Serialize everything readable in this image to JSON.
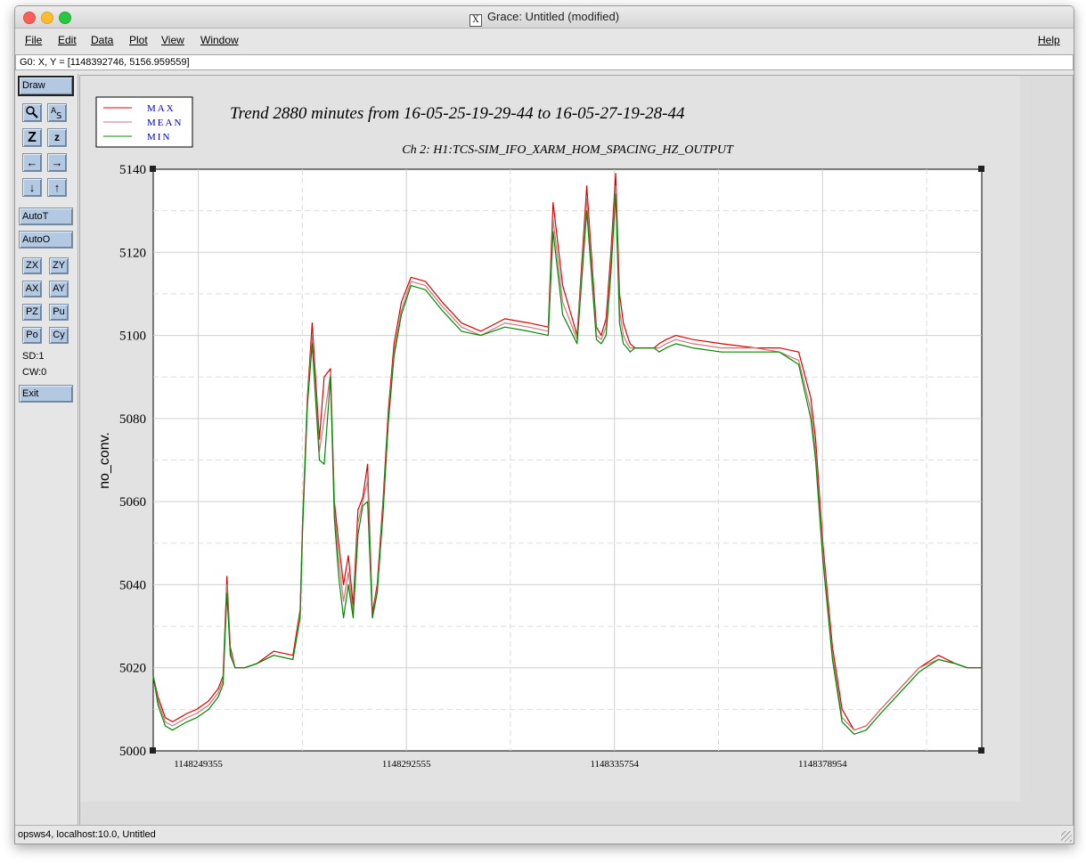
{
  "window": {
    "title": "Grace: Untitled (modified)"
  },
  "menu": {
    "file": "File",
    "edit": "Edit",
    "data": "Data",
    "plot": "Plot",
    "view": "View",
    "window": "Window",
    "help": "Help"
  },
  "status_line": "G0: X, Y = [1148392746, 5156.959559]",
  "toolbar": {
    "draw": "Draw",
    "auto_t": "AutoT",
    "auto_o": "AutoO",
    "zx": "ZX",
    "zy": "ZY",
    "ax": "AX",
    "ay": "AY",
    "pz": "PZ",
    "pu": "Pu",
    "po": "Po",
    "cy": "Cy",
    "sd": "SD:1",
    "cw": "CW:0",
    "exit": "Exit",
    "icons": [
      "magnifier-icon",
      "autoscale-text-icon",
      "zoom-in-icon",
      "zoom-out-icon",
      "arrow-left-icon",
      "arrow-right-icon",
      "arrow-down-icon",
      "arrow-up-icon"
    ]
  },
  "bottom_status": "opsws4, localhost:10.0, Untitled",
  "chart_data": {
    "type": "line",
    "title": "Trend 2880 minutes from 16-05-25-19-29-44 to 16-05-27-19-28-44",
    "subtitle": "Ch 2: H1:TCS-SIM_IFO_XARM_HOM_SPACING_HZ_OUTPUT",
    "xlabel": "",
    "ylabel": "no_conv.",
    "xlim": [
      1148240000,
      1148412000
    ],
    "ylim": [
      5000,
      5140
    ],
    "x_ticks": [
      1148249355,
      1148292555,
      1148335754,
      1148378954
    ],
    "x_tick_labels": [
      "1148249355",
      "1148292555",
      "1148335754",
      "1148378954"
    ],
    "y_ticks": [
      5000,
      5020,
      5040,
      5060,
      5080,
      5100,
      5120,
      5140
    ],
    "y_tick_labels": [
      "5000",
      "5020",
      "5040",
      "5060",
      "5080",
      "5100",
      "5120",
      "5140"
    ],
    "grid": true,
    "legend_position": "top-left",
    "legend": [
      "MAX",
      "MEAN",
      "MIN"
    ],
    "colors": {
      "max": "#dd0000",
      "mean": "#cc7777",
      "min": "#008800",
      "legend_text": "#0000cc"
    },
    "x": [
      1148240000,
      1148241000,
      1148242500,
      1148244000,
      1148245500,
      1148247000,
      1148249000,
      1148251500,
      1148253500,
      1148254500,
      1148255300,
      1148256000,
      1148257000,
      1148259000,
      1148261500,
      1148265000,
      1148269000,
      1148270500,
      1148271000,
      1148272000,
      1148273000,
      1148274500,
      1148275500,
      1148276800,
      1148277600,
      1148278500,
      1148279500,
      1148280500,
      1148281500,
      1148282500,
      1148283500,
      1148284500,
      1148285500,
      1148286500,
      1148287700,
      1148288800,
      1148290000,
      1148291500,
      1148293500,
      1148296500,
      1148300000,
      1148304000,
      1148308000,
      1148313000,
      1148318000,
      1148322000,
      1148323000,
      1148325000,
      1148328000,
      1148330000,
      1148332000,
      1148333000,
      1148334000,
      1148335000,
      1148336000,
      1148336800,
      1148337600,
      1148338400,
      1148339000,
      1148340000,
      1148341000,
      1148342000,
      1148343000,
      1148344000,
      1148345000,
      1148346500,
      1148348500,
      1148352000,
      1148358000,
      1148365000,
      1148370000,
      1148374000,
      1148376500,
      1148377500,
      1148379000,
      1148381000,
      1148383000,
      1148385500,
      1148388000,
      1148391000,
      1148395000,
      1148399000,
      1148403000,
      1148406500,
      1148409000,
      1148412000
    ],
    "series": [
      {
        "name": "MAX",
        "values": [
          5018,
          5013,
          5008,
          5007,
          5008,
          5009,
          5010,
          5012,
          5015,
          5018,
          5042,
          5025,
          5020,
          5020,
          5021,
          5024,
          5023,
          5034,
          5055,
          5085,
          5103,
          5075,
          5090,
          5092,
          5060,
          5050,
          5040,
          5047,
          5035,
          5058,
          5061,
          5069,
          5033,
          5040,
          5060,
          5082,
          5098,
          5108,
          5114,
          5113,
          5108,
          5103,
          5101,
          5104,
          5103,
          5102,
          5132,
          5112,
          5100,
          5136,
          5102,
          5100,
          5104,
          5120,
          5139,
          5110,
          5103,
          5100,
          5098,
          5097,
          5097,
          5097,
          5097,
          5097,
          5098,
          5099,
          5100,
          5099,
          5098,
          5097,
          5097,
          5096,
          5085,
          5075,
          5050,
          5025,
          5010,
          5005,
          5006,
          5010,
          5015,
          5020,
          5023,
          5021,
          5020,
          5020
        ]
      },
      {
        "name": "MEAN",
        "values": [
          5018,
          5012,
          5007,
          5006,
          5007,
          5008,
          5009,
          5011,
          5014,
          5017,
          5040,
          5024,
          5020,
          5020,
          5021,
          5023,
          5022,
          5033,
          5054,
          5084,
          5100,
          5072,
          5080,
          5091,
          5058,
          5046,
          5036,
          5043,
          5033,
          5055,
          5060,
          5065,
          5032,
          5039,
          5058,
          5080,
          5096,
          5106,
          5113,
          5112,
          5107,
          5102,
          5100,
          5103,
          5102,
          5101,
          5128,
          5108,
          5099,
          5133,
          5100,
          5099,
          5102,
          5117,
          5136,
          5106,
          5100,
          5098,
          5097,
          5097,
          5097,
          5097,
          5097,
          5097,
          5097,
          5098,
          5099,
          5098,
          5097,
          5097,
          5096,
          5094,
          5082,
          5072,
          5048,
          5023,
          5008,
          5005,
          5006,
          5010,
          5015,
          5020,
          5022,
          5021,
          5020,
          5020
        ]
      },
      {
        "name": "MIN",
        "values": [
          5018,
          5011,
          5006,
          5005,
          5006,
          5007,
          5008,
          5010,
          5013,
          5016,
          5038,
          5023,
          5020,
          5020,
          5021,
          5023,
          5022,
          5032,
          5053,
          5083,
          5098,
          5070,
          5069,
          5090,
          5056,
          5042,
          5032,
          5040,
          5032,
          5052,
          5059,
          5060,
          5032,
          5038,
          5057,
          5079,
          5095,
          5105,
          5112,
          5111,
          5106,
          5101,
          5100,
          5102,
          5101,
          5100,
          5125,
          5105,
          5098,
          5130,
          5099,
          5098,
          5100,
          5115,
          5134,
          5103,
          5098,
          5097,
          5096,
          5097,
          5097,
          5097,
          5097,
          5097,
          5096,
          5097,
          5098,
          5097,
          5096,
          5096,
          5096,
          5093,
          5080,
          5070,
          5046,
          5022,
          5007,
          5004,
          5005,
          5009,
          5014,
          5019,
          5022,
          5021,
          5020,
          5020
        ]
      }
    ]
  }
}
